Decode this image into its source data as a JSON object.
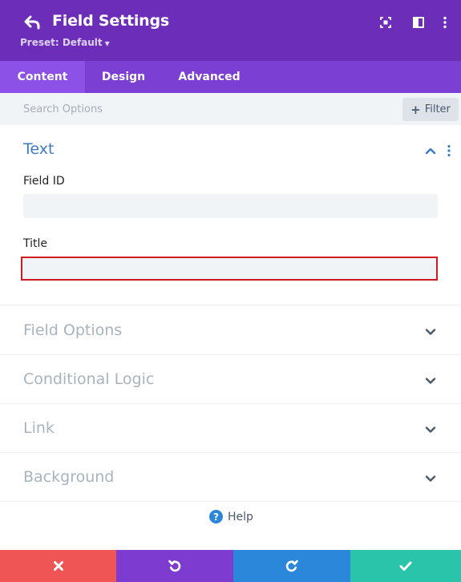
{
  "header": {
    "title": "Field Settings",
    "preset_label": "Preset: Default",
    "icons": [
      "back-arrow-icon",
      "expand-icon",
      "sidebar-layout-icon",
      "more-vertical-icon"
    ]
  },
  "tabs": [
    {
      "label": "Content",
      "active": true
    },
    {
      "label": "Design",
      "active": false
    },
    {
      "label": "Advanced",
      "active": false
    }
  ],
  "search": {
    "placeholder": "Search Options",
    "value": "",
    "filter_label": "Filter"
  },
  "sections": {
    "text": {
      "title": "Text",
      "expanded": true,
      "fields": [
        {
          "label": "Field ID",
          "value": ""
        },
        {
          "label": "Title",
          "value": ""
        }
      ]
    },
    "collapsed": [
      {
        "label": "Field Options"
      },
      {
        "label": "Conditional Logic"
      },
      {
        "label": "Link"
      },
      {
        "label": "Background"
      }
    ]
  },
  "help": {
    "label": "Help"
  },
  "footer": {
    "buttons": [
      "close-icon",
      "undo-icon",
      "redo-icon",
      "save-check-icon"
    ]
  },
  "colors": {
    "header_bg": "#6c2eb9",
    "tabs_bg": "#7b3fd4",
    "tab_active_bg": "#8c52e8",
    "section_title": "#3d7bc4",
    "error_border": "#d01b23",
    "close_btn": "#ef5555",
    "undo_btn": "#7e3bd0",
    "redo_btn": "#2b87da",
    "save_btn": "#29c4a9"
  }
}
